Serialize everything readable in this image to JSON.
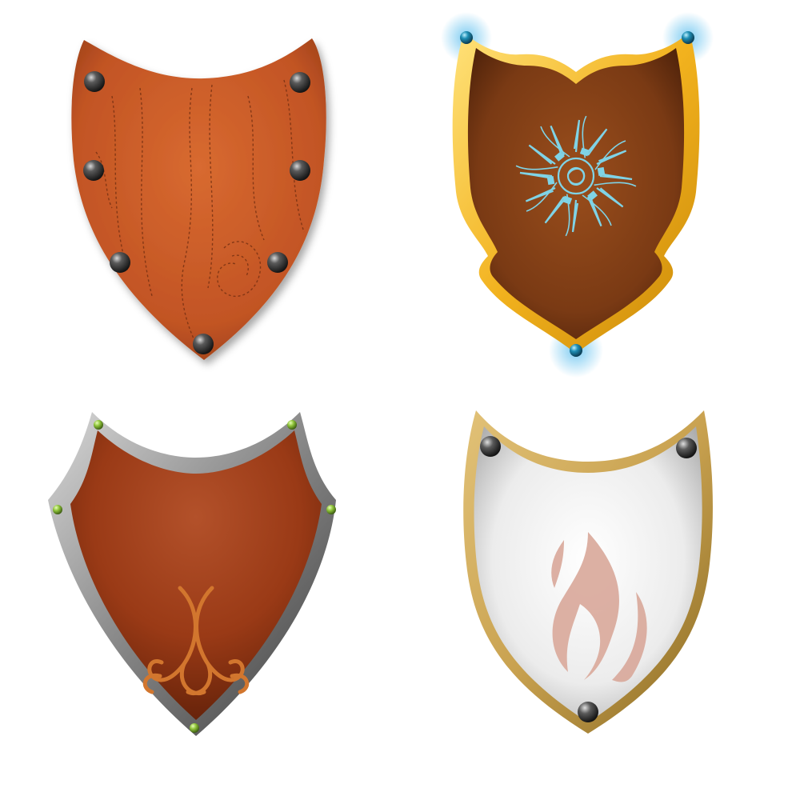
{
  "scene": {
    "background": "#ffffff",
    "item_count": 4
  },
  "shields": [
    {
      "id": "wood",
      "name_icon": "wooden-shield-icon",
      "face_color": "#c45a28",
      "grain_color": "#6e2c10",
      "rivet_color": "#3c3c3c",
      "rivets": 7,
      "emblem_icon": "wood-grain-icon"
    },
    {
      "id": "gold",
      "name_icon": "gold-trim-shield-icon",
      "face_color": "#7a3a14",
      "trim_color": "#f2b21e",
      "emblem_color": "#7fd3e6",
      "rivet_color": "#1f8fb5",
      "glow_color": "#6fc6f0",
      "rivets": 3,
      "emblem_icon": "sun-rune-icon"
    },
    {
      "id": "iron",
      "name_icon": "iron-rim-shield-icon",
      "face_color": "#9a3a16",
      "rim_color": "#8c8c8c",
      "emblem_color": "#d2762e",
      "rivet_color": "#8fc43a",
      "rivets": 5,
      "emblem_icon": "scroll-ornament-icon"
    },
    {
      "id": "flame",
      "name_icon": "white-flame-shield-icon",
      "face_color": "#f2f2f2",
      "rim_color": "#c9a250",
      "emblem_color": "#d9a89a",
      "rivet_color": "#3a3a3a",
      "rivets": 3,
      "emblem_icon": "flame-icon"
    }
  ]
}
